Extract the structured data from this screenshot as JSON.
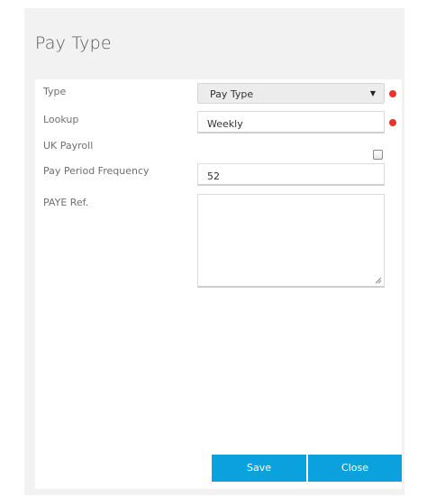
{
  "dialog": {
    "title": "Pay Type"
  },
  "form": {
    "type": {
      "label": "Type",
      "value": "Pay Type",
      "required": true
    },
    "lookup": {
      "label": "Lookup",
      "value": "Weekly",
      "required": true
    },
    "uk_payroll": {
      "label": "UK Payroll",
      "checked": false
    },
    "pay_period_frequency": {
      "label": "Pay Period Frequency",
      "value": "52"
    },
    "paye_ref": {
      "label": "PAYE Ref.",
      "value": ""
    }
  },
  "buttons": {
    "save": "Save",
    "close": "Close"
  },
  "colors": {
    "accent": "#0aa1de",
    "required": "#e8342c"
  }
}
